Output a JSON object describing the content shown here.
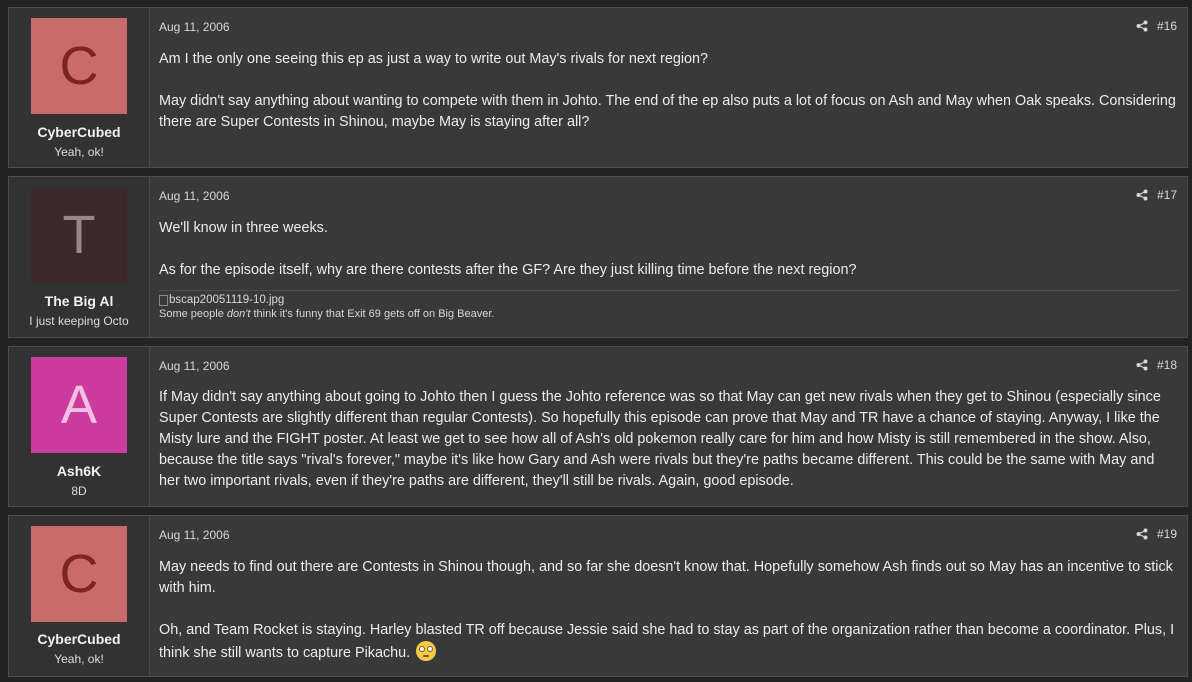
{
  "posts": [
    {
      "avatar_letter": "C",
      "avatar_bg": "#c96b6b",
      "avatar_fg": "#7a2424",
      "username": "CyberCubed",
      "user_title": "Yeah, ok!",
      "date": "Aug 11, 2006",
      "number": "#16",
      "paragraphs": [
        "Am I the only one seeing this ep as just a way to write out May's rivals for next region?",
        "May didn't say anything about wanting to compete with them in Johto. The end of the ep also puts a lot of focus on Ash and May when Oak speaks. Considering there are Super Contests in Shinou, maybe May is staying after all?"
      ]
    },
    {
      "avatar_letter": "T",
      "avatar_bg": "#3c2a2a",
      "avatar_fg": "#9a8888",
      "username": "The Big Al",
      "user_title": "I just keeping Octo",
      "date": "Aug 11, 2006",
      "number": "#17",
      "paragraphs": [
        "We'll know in three weeks.",
        "As for the episode itself, why are there contests after the GF? Are they just killing time before the next region?"
      ],
      "signature": {
        "image_alt": "bscap20051119-10.jpg",
        "text_before": "Some people ",
        "text_em": "don't",
        "text_after": " think it's funny that Exit 69 gets off on Big Beaver."
      }
    },
    {
      "avatar_letter": "A",
      "avatar_bg": "#cc3b9e",
      "avatar_fg": "#f3c0e2",
      "username": "Ash6K",
      "user_title": "8D",
      "date": "Aug 11, 2006",
      "number": "#18",
      "paragraphs": [
        "If May didn't say anything about going to Johto then I guess the Johto reference was so that May can get new rivals when they get to Shinou (especially since Super Contests are slightly different than regular Contests). So hopefully this episode can prove that May and TR have a chance of staying. Anyway, I like the Misty lure and the FIGHT poster. At least we get to see how all of Ash's old pokemon really care for him and how Misty is still remembered in the show. Also, because the title says \"rival's forever,\" maybe it's like how Gary and Ash were rivals but they're paths became different. This could be the same with May and her two important rivals, even if they're paths are different, they'll still be rivals. Again, good episode."
      ]
    },
    {
      "avatar_letter": "C",
      "avatar_bg": "#c96b6b",
      "avatar_fg": "#7a2424",
      "username": "CyberCubed",
      "user_title": "Yeah, ok!",
      "date": "Aug 11, 2006",
      "number": "#19",
      "paragraphs": [
        "May needs to find out there are Contests in Shinou though, and so far she doesn't know that. Hopefully somehow Ash finds out so May has an incentive to stick with him.",
        "Oh, and Team Rocket is staying. Harley blasted TR off because Jessie said she had to stay as part of the organization rather than become a coordinator. Plus, I think she still wants to capture Pikachu."
      ],
      "emoji": "rolling-eyes-emoji"
    }
  ]
}
